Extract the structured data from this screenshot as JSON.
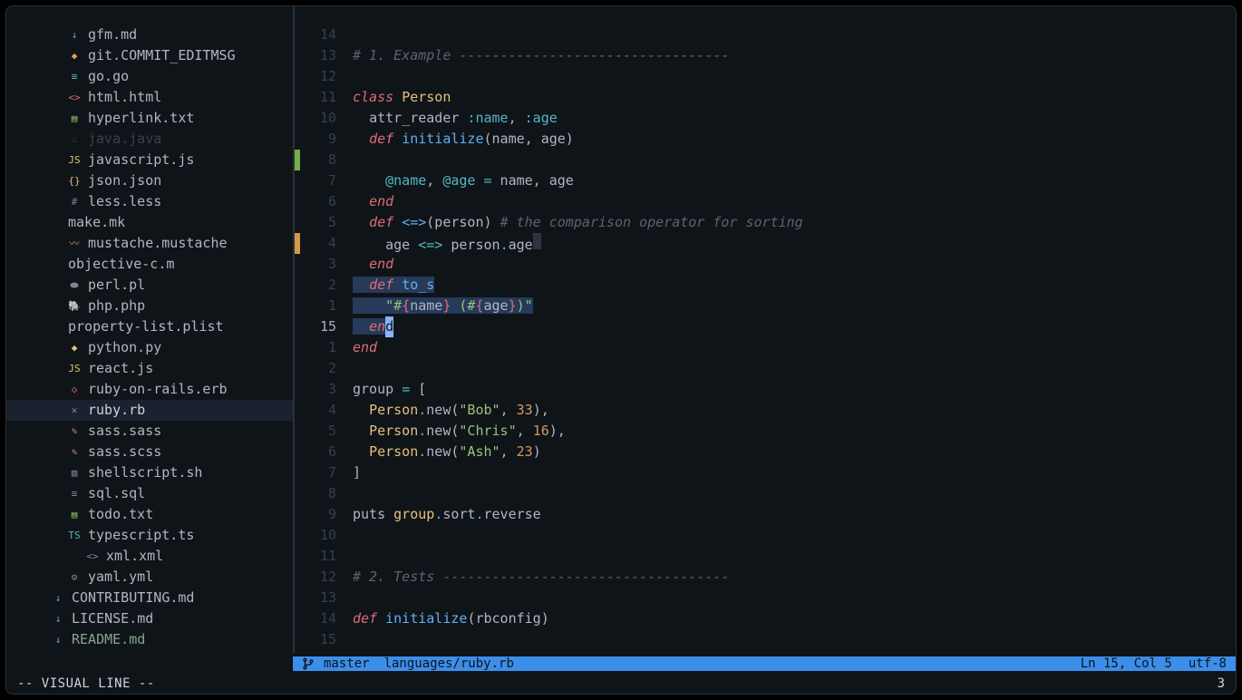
{
  "sidebar": {
    "files": [
      {
        "icon": "↓",
        "iconClass": "ic-md",
        "name": "gfm.md"
      },
      {
        "icon": "◆",
        "iconClass": "ic-orange",
        "name": "git.COMMIT_EDITMSG"
      },
      {
        "icon": "≡",
        "iconClass": "ic-cyan",
        "name": "go.go"
      },
      {
        "icon": "<>",
        "iconClass": "ic-red",
        "name": "html.html"
      },
      {
        "icon": "▤",
        "iconClass": "ic-green",
        "name": "hyperlink.txt"
      },
      {
        "icon": "♨",
        "iconClass": "ic-red",
        "name": "java.java",
        "dim": true
      },
      {
        "icon": "JS",
        "iconClass": "ic-yellow",
        "name": "javascript.js"
      },
      {
        "icon": "{}",
        "iconClass": "ic-yellow",
        "name": "json.json"
      },
      {
        "icon": "#",
        "iconClass": "ic-gray",
        "name": "less.less"
      },
      {
        "icon": "",
        "iconClass": "",
        "name": "make.mk",
        "noIcon": true
      },
      {
        "icon": "〰",
        "iconClass": "ic-orange",
        "name": "mustache.mustache"
      },
      {
        "icon": "",
        "iconClass": "",
        "name": "objective-c.m",
        "noIcon": true
      },
      {
        "icon": "⬬",
        "iconClass": "ic-gray",
        "name": "perl.pl"
      },
      {
        "icon": "🐘",
        "iconClass": "ic-purple",
        "name": "php.php"
      },
      {
        "icon": "",
        "iconClass": "",
        "name": "property-list.plist",
        "noIcon": true
      },
      {
        "icon": "◆",
        "iconClass": "ic-yellow",
        "name": "python.py"
      },
      {
        "icon": "JS",
        "iconClass": "ic-yellow",
        "name": "react.js"
      },
      {
        "icon": "◇",
        "iconClass": "ic-red",
        "name": "ruby-on-rails.erb"
      },
      {
        "icon": "✕",
        "iconClass": "ic-gray",
        "name": "ruby.rb",
        "selected": true
      },
      {
        "icon": "✎",
        "iconClass": "ic-pink",
        "name": "sass.sass"
      },
      {
        "icon": "✎",
        "iconClass": "ic-pink",
        "name": "sass.scss"
      },
      {
        "icon": "▧",
        "iconClass": "ic-gray",
        "name": "shellscript.sh"
      },
      {
        "icon": "≡",
        "iconClass": "ic-gray",
        "name": "sql.sql"
      },
      {
        "icon": "▤",
        "iconClass": "ic-green",
        "name": "todo.txt"
      },
      {
        "icon": "TS",
        "iconClass": "ic-cyan",
        "name": "typescript.ts"
      },
      {
        "icon": "<>",
        "iconClass": "ic-gray",
        "name": "xml.xml",
        "indent": true
      },
      {
        "icon": "⚙",
        "iconClass": "ic-gray",
        "name": "yaml.yml"
      },
      {
        "icon": "↓",
        "iconClass": "ic-md",
        "name": "CONTRIBUTING.md",
        "topLevel": true
      },
      {
        "icon": "↓",
        "iconClass": "ic-md",
        "name": "LICENSE.md",
        "topLevel": true
      },
      {
        "icon": "↓",
        "iconClass": "ic-md",
        "name": "README.md",
        "topLevel": true,
        "greenish": true
      }
    ]
  },
  "editor": {
    "lines": [
      {
        "n": "14",
        "mark": "",
        "html": ""
      },
      {
        "n": "13",
        "mark": "",
        "html": "<span class='cmt'># 1. Example ---------------------------------</span>"
      },
      {
        "n": "12",
        "mark": "",
        "html": ""
      },
      {
        "n": "11",
        "mark": "",
        "html": "<span class='kw'>class</span> <span class='cls'>Person</span>"
      },
      {
        "n": "10",
        "mark": "",
        "html": "  <span class='id'>attr_reader</span> <span class='sym'>:name</span>, <span class='sym'>:age</span>"
      },
      {
        "n": "9",
        "mark": "",
        "html": "  <span class='kw'>def</span> <span class='fn'>initialize</span>(name, age)"
      },
      {
        "n": "8",
        "mark": "green",
        "html": ""
      },
      {
        "n": "7",
        "mark": "",
        "html": "    <span class='ivar'>@name</span>, <span class='ivar'>@age</span> <span class='op'>=</span> name, age"
      },
      {
        "n": "6",
        "mark": "",
        "html": "  <span class='kw'>end</span>"
      },
      {
        "n": "5",
        "mark": "",
        "html": "  <span class='kw'>def</span> <span class='fn'>&lt;=&gt;</span>(person) <span class='cmt'># the comparison operator for sorting</span>"
      },
      {
        "n": "4",
        "mark": "yellow",
        "html": "    age <span class='op'>&lt;=&gt;</span> person<span class='op'>.</span>age<span class='trailws'></span>"
      },
      {
        "n": "3",
        "mark": "",
        "html": "  <span class='kw'>end</span>"
      },
      {
        "n": "2",
        "mark": "",
        "html": "<span class='vsel'>  <span class='kw'>def</span> <span class='fn'>to_s</span></span>"
      },
      {
        "n": "1",
        "mark": "",
        "html": "<span class='vsel'>    <span class='str'>\"#</span><span class='interp'>{</span><span class='id'>name</span><span class='interp'>}</span><span class='str'> (#</span><span class='interp'>{</span><span class='id'>age</span><span class='interp'>}</span><span class='str'>)\"</span></span>"
      },
      {
        "n": "15",
        "current": true,
        "mark": "",
        "html": "<span class='vsel'>  <span class='kw'>en</span></span><span class='cursor-block'>d</span>"
      },
      {
        "n": "1",
        "mark": "",
        "html": "<span class='kw'>end</span>"
      },
      {
        "n": "2",
        "mark": "",
        "html": ""
      },
      {
        "n": "3",
        "mark": "",
        "html": "<span class='id'>group</span> <span class='op'>=</span> ["
      },
      {
        "n": "4",
        "mark": "",
        "html": "  <span class='cls'>Person</span><span class='op'>.</span><span class='call'>new</span>(<span class='str'>\"Bob\"</span>, <span class='num'>33</span>),"
      },
      {
        "n": "5",
        "mark": "",
        "html": "  <span class='cls'>Person</span><span class='op'>.</span><span class='call'>new</span>(<span class='str'>\"Chris\"</span>, <span class='num'>16</span>),"
      },
      {
        "n": "6",
        "mark": "",
        "html": "  <span class='cls'>Person</span><span class='op'>.</span><span class='call'>new</span>(<span class='str'>\"Ash\"</span>, <span class='num'>23</span>)"
      },
      {
        "n": "7",
        "mark": "",
        "html": "]"
      },
      {
        "n": "8",
        "mark": "",
        "html": ""
      },
      {
        "n": "9",
        "mark": "",
        "html": "<span class='id'>puts</span> <span class='var'>group</span><span class='op'>.</span><span class='call'>sort</span><span class='op'>.</span><span class='call'>reverse</span>"
      },
      {
        "n": "10",
        "mark": "",
        "html": ""
      },
      {
        "n": "11",
        "mark": "",
        "html": ""
      },
      {
        "n": "12",
        "mark": "",
        "html": "<span class='cmt'># 2. Tests -----------------------------------</span>"
      },
      {
        "n": "13",
        "mark": "",
        "html": ""
      },
      {
        "n": "14",
        "mark": "",
        "html": "<span class='kw'>def</span> <span class='fn'>initialize</span>(rbconfig)"
      },
      {
        "n": "15",
        "mark": "",
        "html": ""
      }
    ]
  },
  "status": {
    "branch": "master",
    "filepath": "languages/ruby.rb",
    "position": "Ln 15, Col 5",
    "encoding": "utf-8"
  },
  "mode": {
    "label": "-- VISUAL LINE --",
    "right": "3"
  }
}
